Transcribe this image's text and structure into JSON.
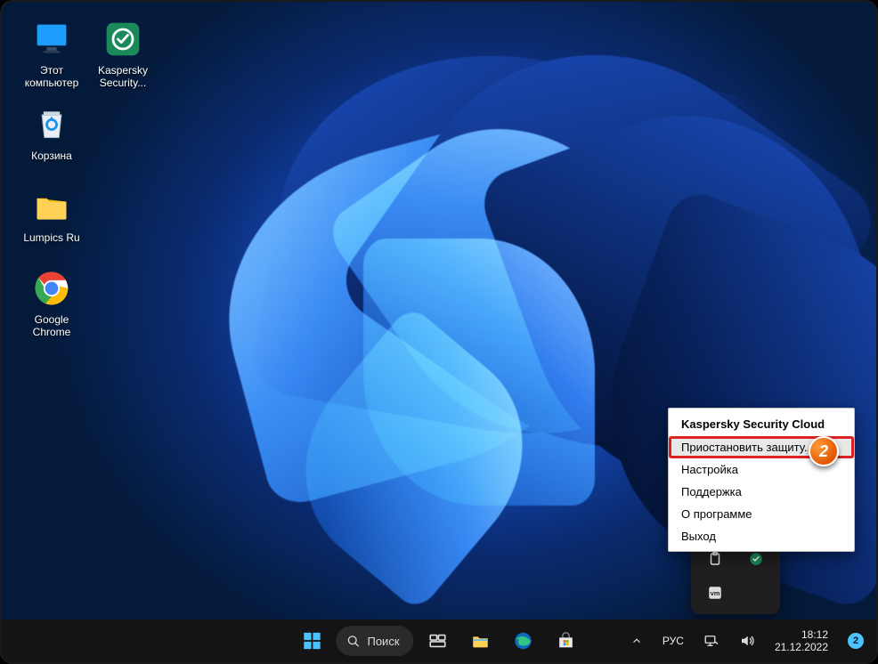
{
  "desktop_icons": [
    {
      "id": "this-pc",
      "label": "Этот\nкомпьютер"
    },
    {
      "id": "kaspersky",
      "label": "Kaspersky\nSecurity..."
    },
    {
      "id": "recycle",
      "label": "Корзина"
    },
    {
      "id": "lumpics",
      "label": "Lumpics Ru"
    },
    {
      "id": "chrome",
      "label": "Google\nChrome"
    }
  ],
  "context_menu": {
    "title": "Kaspersky Security Cloud",
    "items": [
      {
        "label": "Приостановить защиту...",
        "highlight": true
      },
      {
        "label": "Настройка"
      },
      {
        "label": "Поддержка"
      },
      {
        "label": "О программе"
      },
      {
        "label": "Выход"
      }
    ]
  },
  "annotation": {
    "step": "2"
  },
  "taskbar": {
    "search_label": "Поиск",
    "language": "РУС",
    "time": "18:12",
    "date": "21.12.2022",
    "notif_count": "2"
  },
  "colors": {
    "kaspersky_green": "#1b8a5a",
    "accent_blue": "#4cc2ff"
  }
}
